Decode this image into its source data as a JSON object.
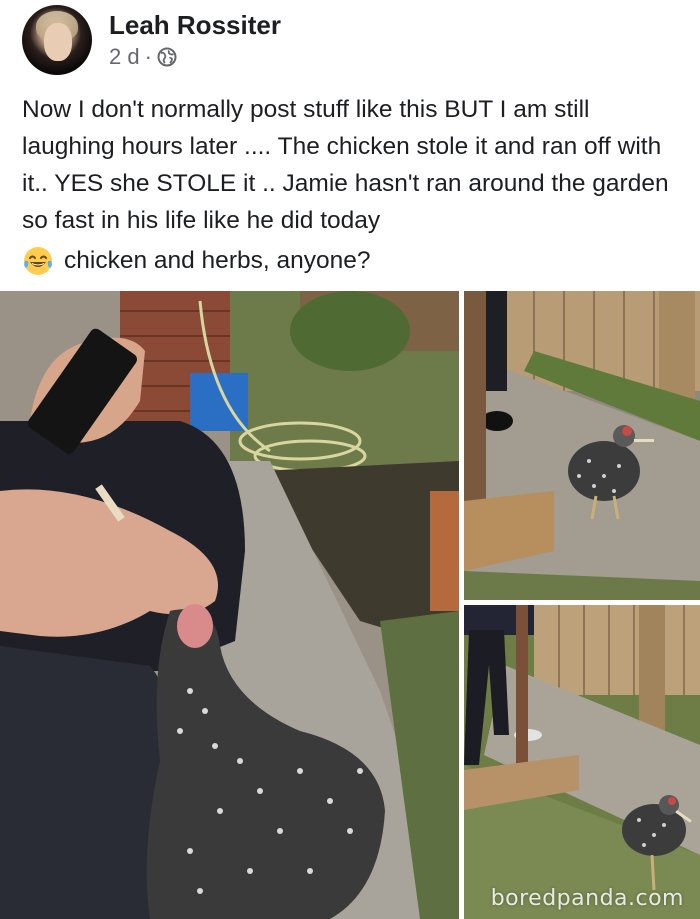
{
  "post": {
    "author": "Leah Rossiter",
    "time": "2 d",
    "separator": "·",
    "privacy_icon": "globe-icon",
    "paragraph": "Now I don't normally post stuff like this BUT I am still laughing hours later .... The chicken stole it and ran off with it.. YES she STOLE it .. Jamie hasn't ran around the garden so fast in his life like he did today",
    "emoji_icon": "laughing-tears-icon",
    "emoji_line": "chicken and herbs, anyone?"
  },
  "photos": [
    {
      "name": "photo-hand-chicken",
      "description_icon": "photo"
    },
    {
      "name": "photo-chicken-path",
      "description_icon": "photo"
    },
    {
      "name": "photo-chicken-garden",
      "description_icon": "photo"
    }
  ],
  "watermark": "boredpanda.com"
}
